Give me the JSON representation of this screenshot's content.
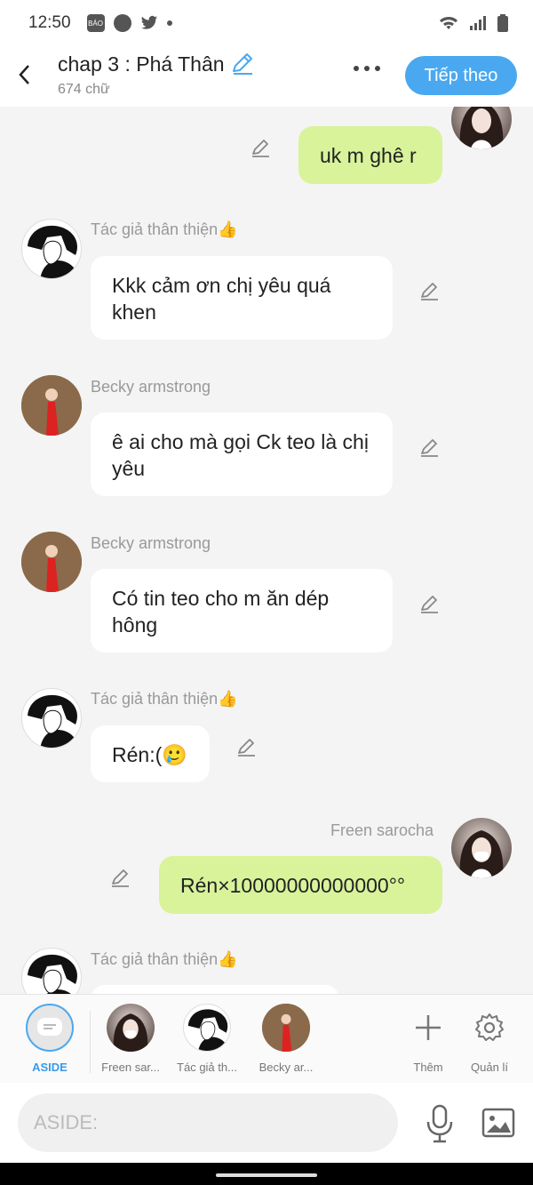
{
  "status": {
    "time": "12:50"
  },
  "header": {
    "title": "chap 3 : Phá Thân",
    "word_count": "674 chữ",
    "next_label": "Tiếp theo"
  },
  "messages": [
    {
      "sender": "",
      "text": "uk m ghê r"
    },
    {
      "sender": "Tác giả thân thiện👍",
      "text": "Kkk cảm ơn chị yêu quá khen"
    },
    {
      "sender": "Becky armstrong",
      "text": "ê ai cho mà gọi Ck teo là chị yêu"
    },
    {
      "sender": "Becky armstrong",
      "text": "Có tin teo cho m ăn dép hông"
    },
    {
      "sender": "Tác giả thân thiện👍",
      "text": "Rén:(🥲"
    },
    {
      "sender": "Freen sarocha",
      "text": "Rén×10000000000000°°"
    },
    {
      "sender": "Tác giả thân thiện👍",
      "text": ""
    }
  ],
  "tabs": [
    {
      "label": "ASIDE"
    },
    {
      "label": "Freen sar..."
    },
    {
      "label": "Tác giả th..."
    },
    {
      "label": "Becky ar..."
    },
    {
      "label": "Thêm"
    },
    {
      "label": "Quản lí"
    }
  ],
  "input": {
    "placeholder": "ASIDE:"
  },
  "colors": {
    "accent": "#4aa8f0",
    "my_bubble": "#d8f39a",
    "background": "#f4f4f4"
  }
}
